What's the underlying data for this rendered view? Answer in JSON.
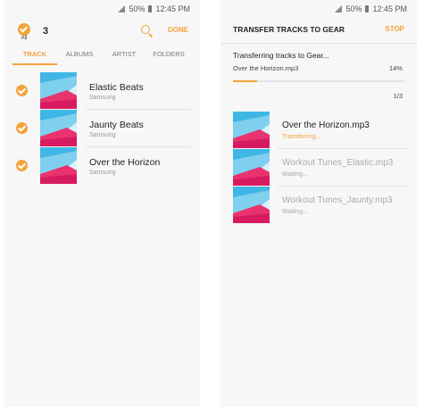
{
  "status_bar": {
    "battery": "50%",
    "time": "12:45 PM"
  },
  "select_screen": {
    "all_label": "All",
    "selected_count": "3",
    "done_label": "DONE",
    "tabs": [
      {
        "label": "TRACK",
        "active": true
      },
      {
        "label": "ALBUMS",
        "active": false
      },
      {
        "label": "ARTIST",
        "active": false
      },
      {
        "label": "FOLDERS",
        "active": false
      }
    ],
    "tracks": [
      {
        "title": "Elastic Beats",
        "artist": "Samsung",
        "checked": true
      },
      {
        "title": "Jaunty Beats",
        "artist": "Samsung",
        "checked": true
      },
      {
        "title": "Over the Horizon",
        "artist": "Samsung",
        "checked": true
      }
    ]
  },
  "transfer_screen": {
    "title": "TRANSFER TRACKS TO GEAR",
    "stop_label": "STOP",
    "progress_title": "Transferring tracks to Gear...",
    "current_file": "Over the Horizon.mp3",
    "percent_label": "14%",
    "progress_fraction": 0.14,
    "count_label": "1/3",
    "items": [
      {
        "name": "Over the Horizon.mp3",
        "status": "Transferring...",
        "state": "active"
      },
      {
        "name": "Workout Tunes_Elastic.mp3",
        "status": "Waiting...",
        "state": "waiting"
      },
      {
        "name": "Workout Tunes_Jaunty.mp3",
        "status": "Waiting...",
        "state": "waiting"
      }
    ]
  },
  "colors": {
    "accent": "#f2a33a",
    "background": "#f7f7f7"
  },
  "icons": [
    "signal-icon",
    "battery-icon",
    "search-icon",
    "check-circle-icon"
  ]
}
